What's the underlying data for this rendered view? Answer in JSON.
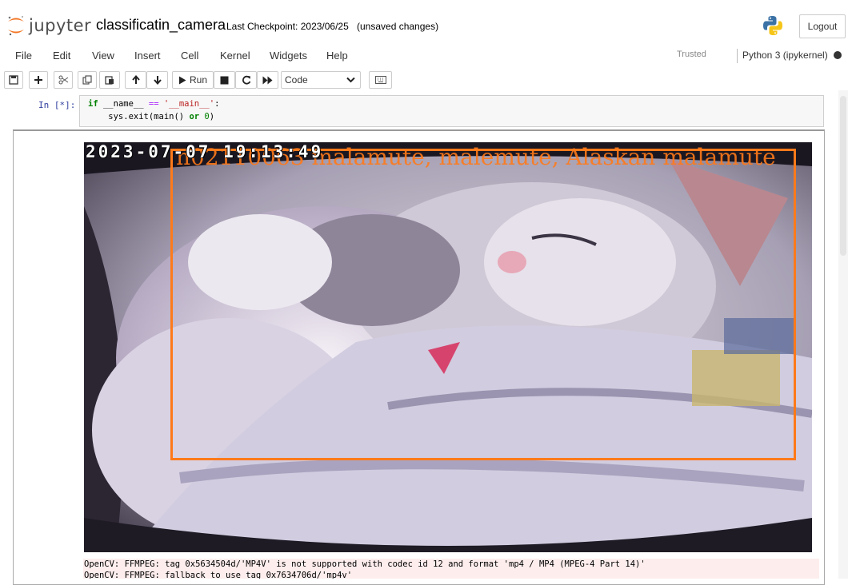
{
  "header": {
    "logo_text": "jupyter",
    "notebook_name": "classificatin_camera",
    "checkpoint": "Last Checkpoint: 2023/06/25",
    "unsaved": "(unsaved changes)",
    "logout_label": "Logout"
  },
  "menu": {
    "items": [
      "File",
      "Edit",
      "View",
      "Insert",
      "Cell",
      "Kernel",
      "Widgets",
      "Help"
    ],
    "trusted_label": "Trusted",
    "kernel_name": "Python 3 (ipykernel)"
  },
  "toolbar": {
    "run_label": "Run",
    "cell_type": "Code",
    "buttons": [
      "save-icon",
      "plus-icon",
      "cut-icon",
      "copy-icon",
      "paste-icon",
      "arrow-up-icon",
      "arrow-down-icon",
      "play-icon",
      "stop-icon",
      "restart-icon",
      "fast-forward-icon",
      "keyboard-icon"
    ]
  },
  "cell": {
    "prompt": "In [*]:",
    "line1": {
      "kw_if": "if",
      "name": " __name__ ",
      "op": "==",
      "sp": " ",
      "str": "'__main__'",
      "colon": ":"
    },
    "line2": {
      "text": "    sys.exit(main() ",
      "kw_or": "or",
      "sp": " ",
      "num": "0",
      "close": ")"
    }
  },
  "output": {
    "timestamp": "2023-07-07 19:13:49",
    "class_label": "n02110063 malamute, malemute, Alaskan malamute",
    "stderr": [
      "OpenCV: FFMPEG: tag 0x5634504d/'MP4V' is not supported with codec id 12 and format 'mp4 / MP4 (MPEG-4 Part 14)'",
      "OpenCV: FFMPEG: fallback to use tag 0x7634706d/'mp4v'"
    ]
  },
  "colors": {
    "bbox": "#ff7a1a",
    "prompt": "#303f9f",
    "stderr_bg": "#fdeded"
  }
}
